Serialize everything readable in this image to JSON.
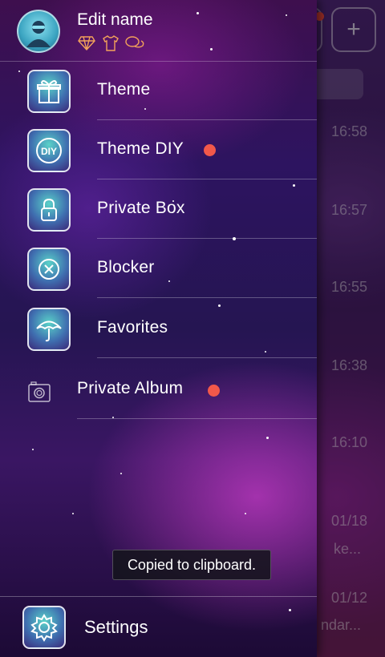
{
  "background": {
    "times": [
      "16:58",
      "16:57",
      "16:55",
      "16:38",
      "16:10",
      "01/18",
      "01/12"
    ],
    "snippets": [
      "ke...",
      "ndar..."
    ],
    "add_button_icon": "plus-icon"
  },
  "drawer": {
    "profile": {
      "name": "Edit name",
      "avatar_icon": "person-avatar-icon",
      "badge_icons": [
        "diamond-icon",
        "tshirt-icon",
        "chat-bubbles-icon"
      ]
    },
    "menu": [
      {
        "label": "Theme",
        "icon": "gift-icon",
        "badge": false
      },
      {
        "label": "Theme DIY",
        "icon": "diy-icon",
        "badge": true
      },
      {
        "label": "Private Box",
        "icon": "lock-icon",
        "badge": false
      },
      {
        "label": "Blocker",
        "icon": "block-icon",
        "badge": false
      },
      {
        "label": "Favorites",
        "icon": "umbrella-icon",
        "badge": false
      },
      {
        "label": "Private Album",
        "icon": "camera-icon",
        "badge": true
      }
    ],
    "settings": {
      "label": "Settings",
      "icon": "gear-icon"
    }
  },
  "toast": {
    "text": "Copied to clipboard."
  },
  "colors": {
    "badge_dot": "#f2584a",
    "icon_glow": "#5ad2c8"
  }
}
